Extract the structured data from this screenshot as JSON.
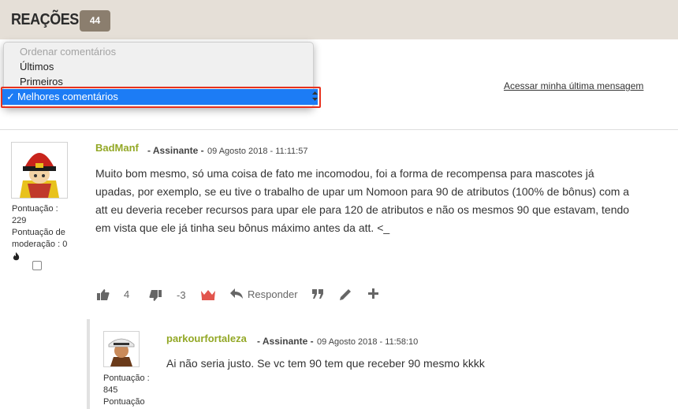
{
  "header": {
    "title": "REAÇÕES",
    "count": "44"
  },
  "last_message_link": "Acessar minha última mensagem",
  "sort_dropdown": {
    "options": [
      {
        "label": "Ordenar comentários",
        "disabled": true
      },
      {
        "label": "Últimos",
        "disabled": false
      },
      {
        "label": "Primeiros",
        "disabled": false
      },
      {
        "label": "Melhores comentários",
        "disabled": false
      }
    ],
    "selected": "Melhores comentários",
    "check_mark": "✓"
  },
  "comments": [
    {
      "username": "BadManf",
      "role": "- Assinante -",
      "date": "09 Agosto 2018 - 11:11:57",
      "score_label": "Pontuação :",
      "score": "229",
      "moderation_label": "Pontuação de moderação : 0",
      "text": "Muito bom mesmo, só uma coisa de fato me incomodou, foi a forma de recompensa para mascotes já upadas, por exemplo, se eu tive o trabalho de upar um Nomoon para 90 de atributos (100% de bônus) com a att eu deveria receber recursos para upar ele para 120 de atributos e não os mesmos 90 que estavam, tendo em vista que ele já tinha seu bônus máximo antes da att. <_",
      "likes": "4",
      "dislikes": "-3",
      "reply_label": "Responder"
    },
    {
      "username": "parkourfortaleza",
      "role": "- Assinante -",
      "date": "09 Agosto 2018 - 11:58:10",
      "score_label": "Pontuação :",
      "score": "845",
      "moderation_label": "Pontuação",
      "text": "Ai não seria justo. Se vc tem 90 tem que receber 90 mesmo kkkk"
    }
  ],
  "colors": {
    "header_bg": "#e5dfd7",
    "count_badge": "#8b7e6e",
    "username": "#93a826",
    "selection": "#1c7cf5",
    "highlight_border": "#e8321e",
    "crown": "#e2554d"
  }
}
